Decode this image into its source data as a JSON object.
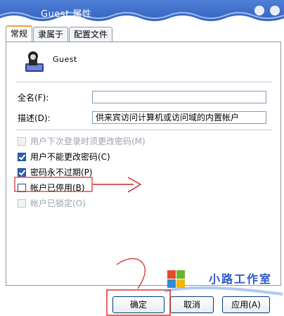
{
  "window": {
    "title": "Guest 属性"
  },
  "tabs": [
    {
      "label": "常规",
      "active": true
    },
    {
      "label": "隶属于",
      "active": false
    },
    {
      "label": "配置文件",
      "active": false
    }
  ],
  "user": {
    "name": "Guest"
  },
  "form": {
    "fullname_label": "全名(F):",
    "fullname_value": "",
    "description_label": "描述(D):",
    "description_value": "供来宾访问计算机或访问域的内置帐户"
  },
  "checkboxes": [
    {
      "label": "用户下次登录时须更改密码(M)",
      "checked": false,
      "enabled": false
    },
    {
      "label": "用户不能更改密码(C)",
      "checked": true,
      "enabled": true
    },
    {
      "label": "密码永不过期(P)",
      "checked": true,
      "enabled": true
    },
    {
      "label": "帐户已停用(B)",
      "checked": false,
      "enabled": true
    },
    {
      "label": "帐户已锁定(O)",
      "checked": false,
      "enabled": false
    }
  ],
  "buttons": {
    "ok": "确定",
    "cancel": "取消",
    "apply": "应用(A)"
  },
  "watermark": {
    "text": "小路工作室"
  },
  "colors": {
    "title_bar": "#3a6ac8",
    "annotation": "#d62020",
    "accent_tab": "#e8a23a"
  }
}
